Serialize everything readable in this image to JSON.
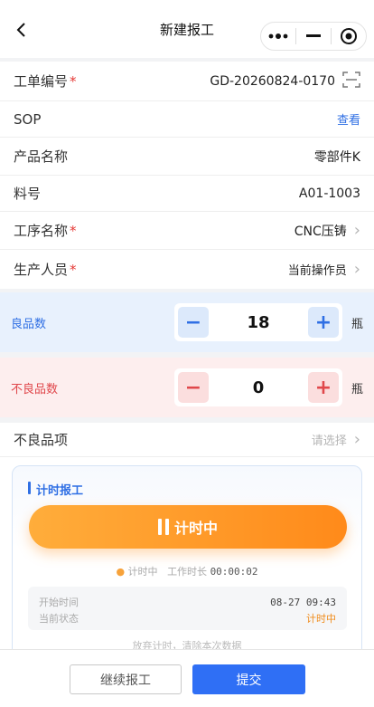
{
  "nav": {
    "title": "新建报工"
  },
  "fields": {
    "order_no": {
      "label": "工单编号",
      "value": "GD-20260824-0170"
    },
    "sop": {
      "label": "SOP",
      "link": "查看"
    },
    "product": {
      "label": "产品名称",
      "value": "零部件K"
    },
    "material": {
      "label": "料号",
      "value": "A01-1003"
    },
    "process": {
      "label": "工序名称",
      "value": "CNC压铸"
    },
    "operator": {
      "label": "生产人员",
      "value": "当前操作员"
    },
    "required_mark": "*"
  },
  "good": {
    "label": "良品数",
    "value": "18",
    "unit": "瓶",
    "minus": "−",
    "plus": "+"
  },
  "bad": {
    "label": "不良品数",
    "value": "0",
    "unit": "瓶",
    "minus": "−",
    "plus": "+"
  },
  "defect": {
    "label": "不良品项",
    "placeholder": "请选择"
  },
  "timer": {
    "title": "计时报工",
    "button_label": "计时中",
    "status_dot": "●",
    "status_text": "计时中",
    "duration_label": "工作时长",
    "duration_value": "00:00:02",
    "start_label": "开始时间",
    "start_value": "08-27 09:43",
    "state_label": "当前状态",
    "state_value": "计时中",
    "discard_text": "放弃计时，清除本次数据"
  },
  "footer": {
    "continue_label": "继续报工",
    "submit_label": "提交"
  },
  "colors": {
    "primary": "#2f6ff5",
    "accent_orange": "#ff8a1a",
    "danger": "#e0474b"
  }
}
